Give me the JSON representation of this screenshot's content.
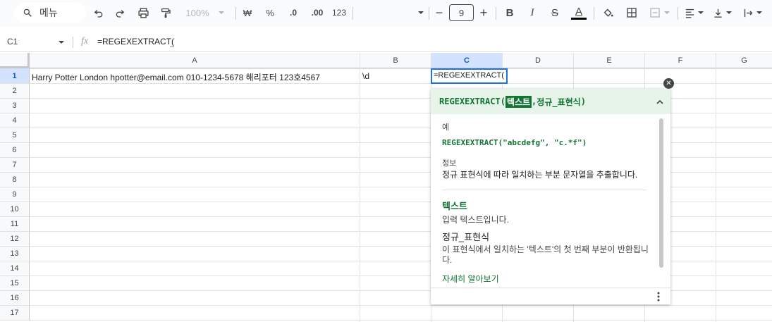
{
  "toolbar": {
    "menu_label": "메뉴",
    "zoom": "100%",
    "currency_symbol": "₩",
    "percent_symbol": "%",
    "decrease_decimal": ".0",
    "increase_decimal": ".00",
    "number_format": "123",
    "font_size": "9",
    "minus_symbol": "−",
    "plus_symbol": "+",
    "bold": "B",
    "italic": "I",
    "strike": "S",
    "text_color": "A"
  },
  "formula_bar": {
    "cell_ref": "C1",
    "fx": "fx",
    "formula": "=REGEXEXTRACT("
  },
  "columns": [
    "A",
    "B",
    "C",
    "D",
    "E",
    "F",
    "G"
  ],
  "rows": [
    "1",
    "2",
    "3",
    "4",
    "5",
    "6",
    "7",
    "8",
    "9",
    "10",
    "11",
    "12",
    "13",
    "14",
    "15",
    "16",
    "17"
  ],
  "cells": {
    "A1": "Harry Potter London hpotter@email.com 010-1234-5678 해리포터 123호4567",
    "B1": "\\d",
    "C1": "=REGEXEXTRACT("
  },
  "help": {
    "fn_name": "REGEXEXTRACT(",
    "arg1": "텍스트",
    "arg_sep": ", ",
    "arg2": "정규_표현식",
    "close_paren": ")",
    "example_label": "예",
    "example": "REGEXEXTRACT(\"abcdefg\", \"c.*f\")",
    "info_label": "정보",
    "info_text": "정규 표현식에 따라 일치하는 부분 문자열을 추출합니다.",
    "param1_name": "텍스트",
    "param1_desc": "입력 텍스트입니다.",
    "param2_name": "정규_표현식",
    "param2_desc": "이 표현식에서 일치하는 '텍스트'의 첫 번째 부분이 반환됩니다.",
    "learn_more": "자세히 알아보기"
  },
  "colors": {
    "accent_green": "#137333",
    "selection_blue": "#1a73e8"
  }
}
